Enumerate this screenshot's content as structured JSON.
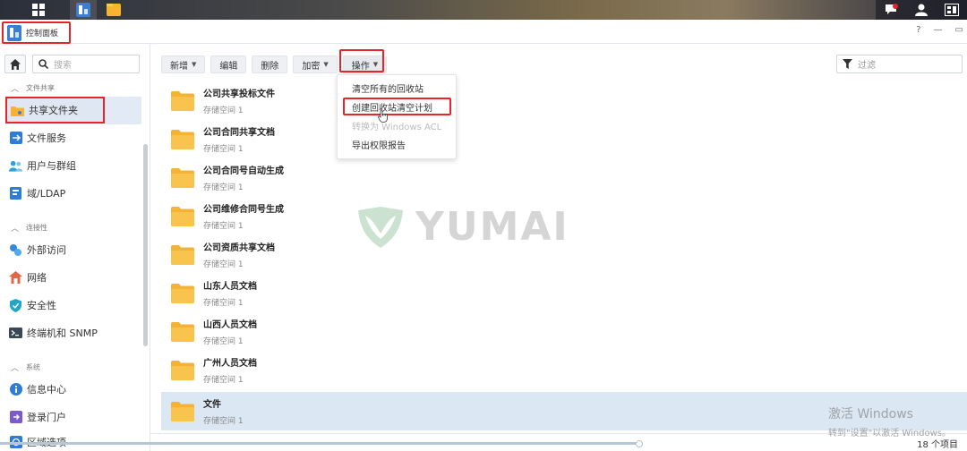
{
  "window": {
    "title": "控制面板",
    "help": "?",
    "minimize": "—",
    "restore": "▭"
  },
  "sidebar": {
    "search_placeholder": "搜索",
    "sections": [
      {
        "label": "文件共享"
      },
      {
        "label": "连接性"
      },
      {
        "label": "系统"
      }
    ],
    "items": [
      {
        "label": "共享文件夹",
        "icon": "shared-folder-icon"
      },
      {
        "label": "文件服务",
        "icon": "file-services-icon"
      },
      {
        "label": "用户与群组",
        "icon": "users-groups-icon"
      },
      {
        "label": "域/LDAP",
        "icon": "domain-ldap-icon"
      },
      {
        "label": "外部访问",
        "icon": "external-access-icon"
      },
      {
        "label": "网络",
        "icon": "network-icon"
      },
      {
        "label": "安全性",
        "icon": "security-shield-icon"
      },
      {
        "label": "终端机和 SNMP",
        "icon": "terminal-icon"
      },
      {
        "label": "信息中心",
        "icon": "info-center-icon"
      },
      {
        "label": "登录门户",
        "icon": "login-portal-icon"
      },
      {
        "label": "区域选项",
        "icon": "regional-options-icon"
      }
    ]
  },
  "toolbar": {
    "create": "新增",
    "edit": "编辑",
    "delete": "删除",
    "encrypt": "加密",
    "action": "操作",
    "filter_placeholder": "过滤"
  },
  "menu": {
    "items": [
      {
        "label": "清空所有的回收站",
        "disabled": false
      },
      {
        "label": "创建回收站清空计划",
        "disabled": false
      },
      {
        "label": "转换为 Windows ACL",
        "disabled": true
      },
      {
        "label": "导出权限报告",
        "disabled": false
      }
    ]
  },
  "folders": [
    {
      "name": "公司共享投标文件",
      "sub": "存储空间 1"
    },
    {
      "name": "公司合同共享文档",
      "sub": "存储空间 1"
    },
    {
      "name": "公司合同号自动生成",
      "sub": "存储空间 1"
    },
    {
      "name": "公司维修合同号生成",
      "sub": "存储空间 1"
    },
    {
      "name": "公司资质共享文档",
      "sub": "存储空间 1"
    },
    {
      "name": "山东人员文档",
      "sub": "存储空间 1"
    },
    {
      "name": "山西人员文档",
      "sub": "存储空间 1"
    },
    {
      "name": "广州人员文档",
      "sub": "存储空间 1"
    },
    {
      "name": "文件",
      "sub": "存储空间 1"
    }
  ],
  "status": {
    "count": "18 个项目"
  },
  "watermark": "YUMAI",
  "activation": {
    "title": "激活 Windows",
    "sub": "转到\"设置\"以激活 Windows。"
  },
  "colors": {
    "highlight_red": "#e5252a",
    "selection_blue": "#dbe7f3",
    "folder_yellow": "#f5c344"
  }
}
